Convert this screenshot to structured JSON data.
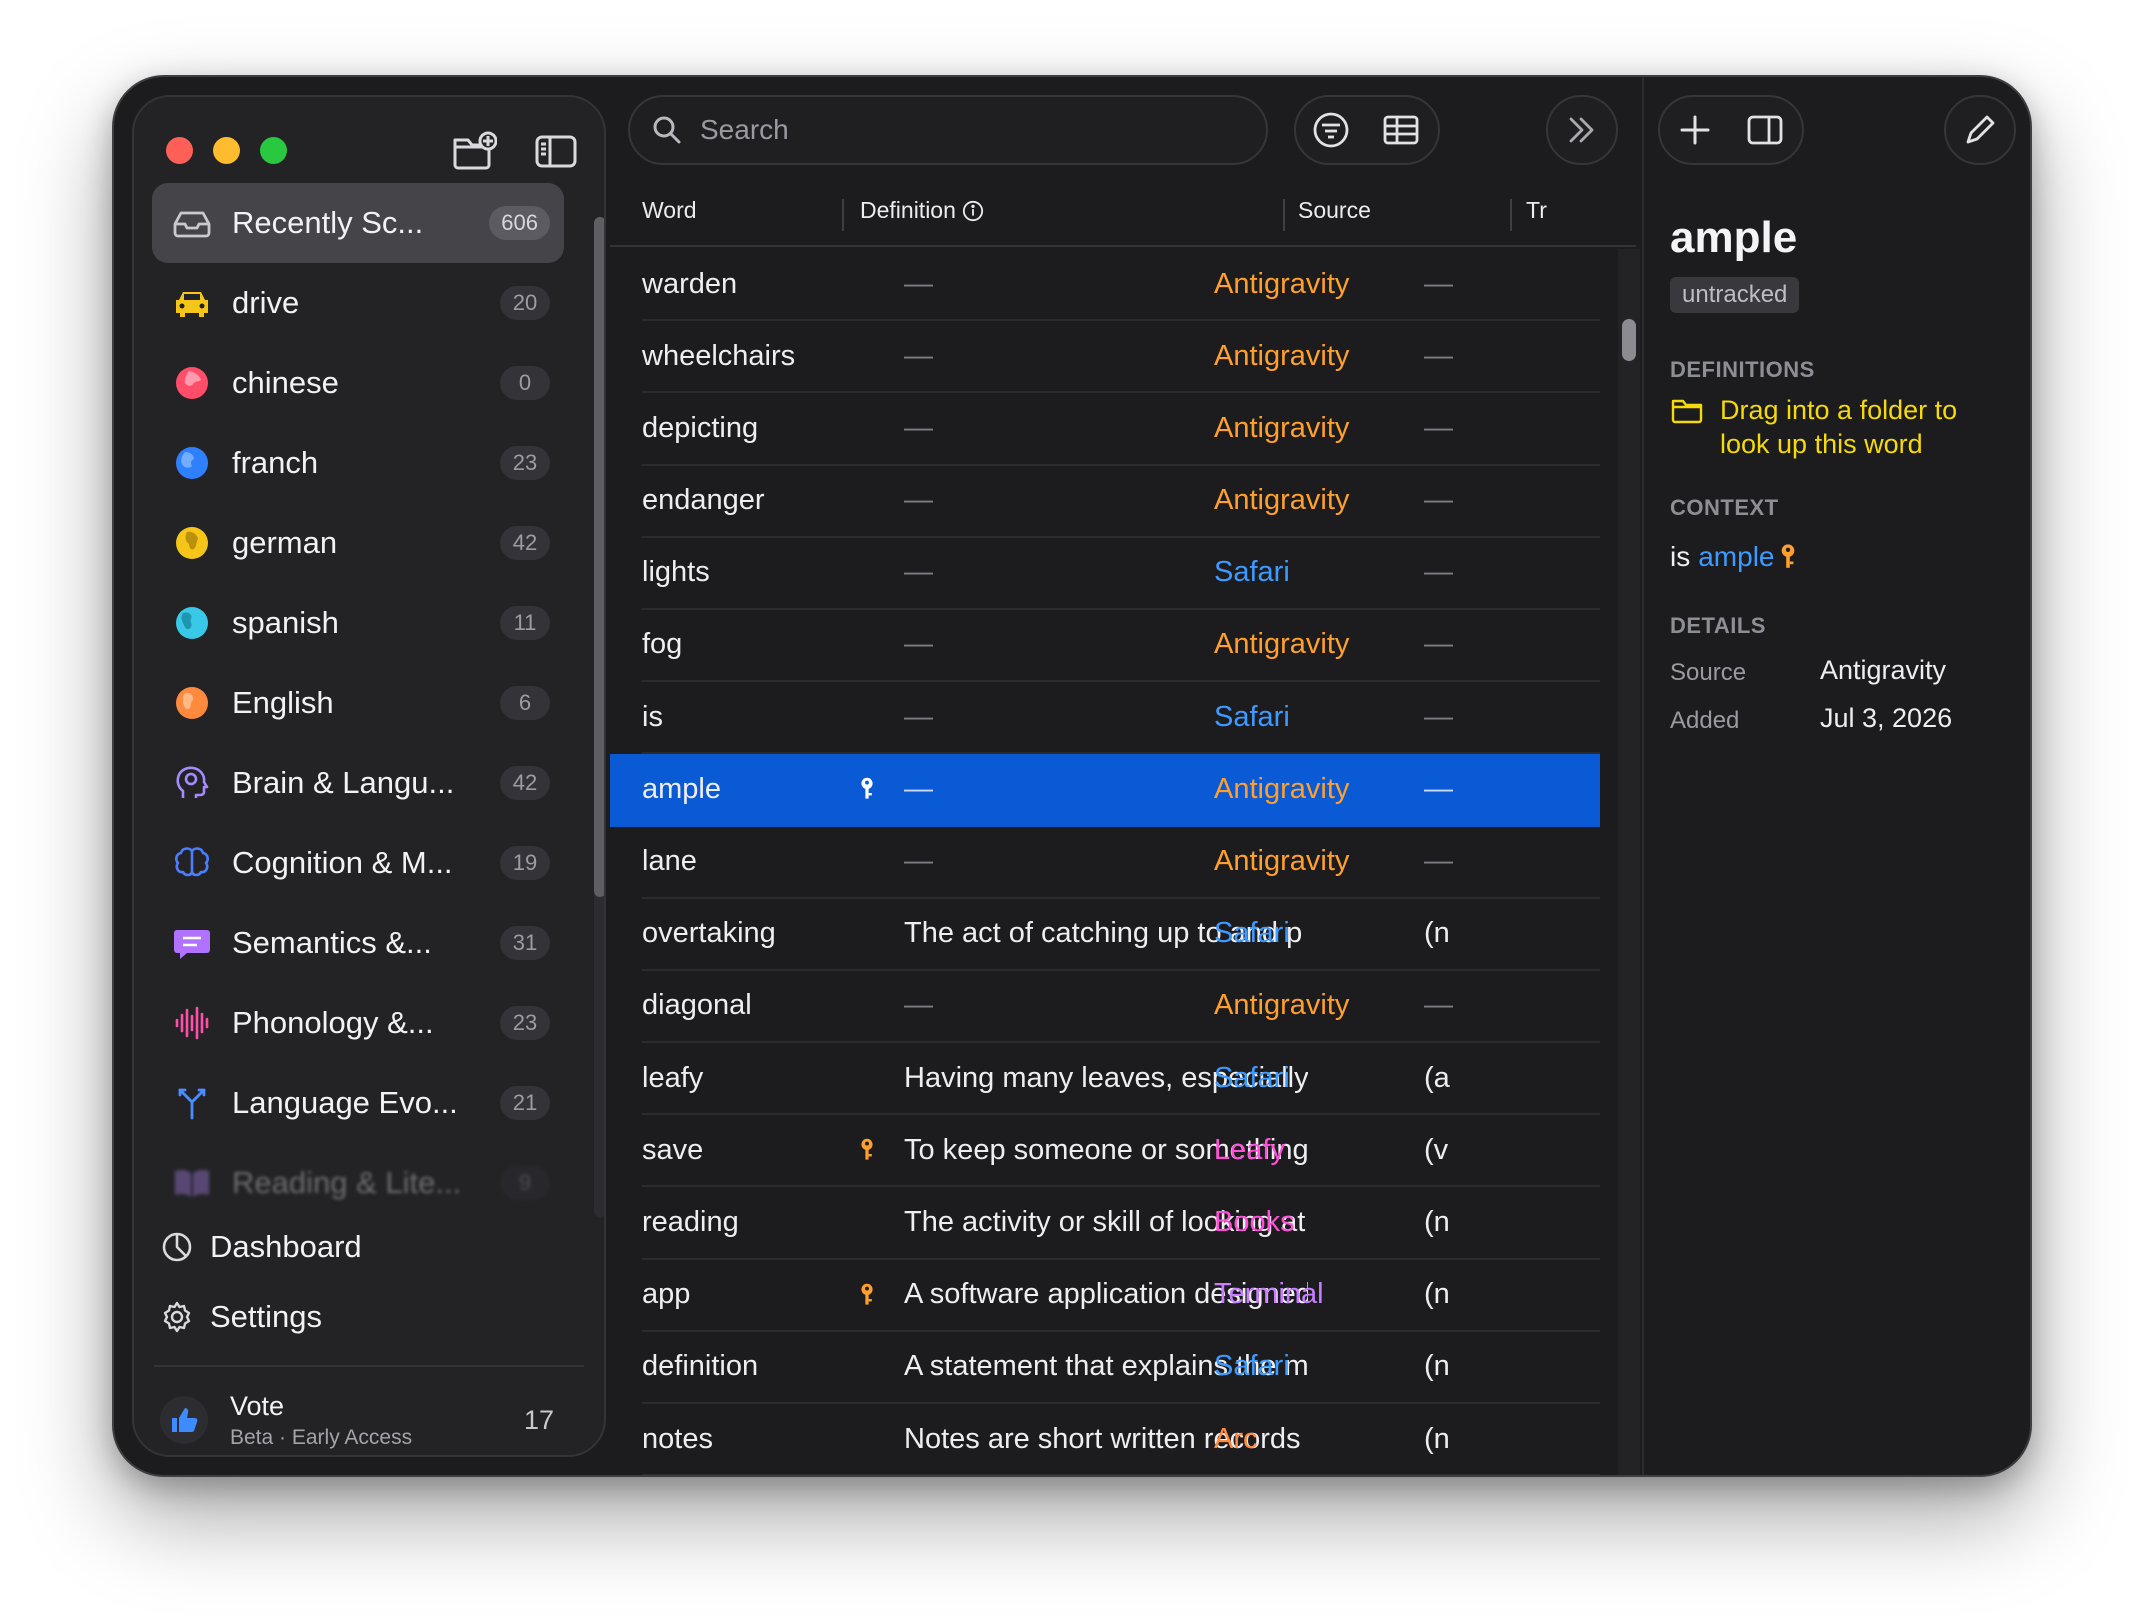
{
  "sidebar": {
    "items": [
      {
        "label": "Recently Sc...",
        "count": "606",
        "icon": "tray-icon",
        "color": "#c9c9ce"
      },
      {
        "label": "drive",
        "count": "20",
        "icon": "car-icon",
        "color": "#f5c518"
      },
      {
        "label": "chinese",
        "count": "0",
        "icon": "globe-asia-icon",
        "color": "#ff4d6a"
      },
      {
        "label": "franch",
        "count": "23",
        "icon": "globe-europe-icon",
        "color": "#2f80ff"
      },
      {
        "label": "german",
        "count": "42",
        "icon": "globe-africa-icon",
        "color": "#f5c518"
      },
      {
        "label": "spanish",
        "count": "11",
        "icon": "globe-americas-icon",
        "color": "#38c9e8"
      },
      {
        "label": "English",
        "count": "6",
        "icon": "globe-icon",
        "color": "#ff8a3d"
      },
      {
        "label": "Brain & Langu...",
        "count": "42",
        "icon": "head-profile-icon",
        "color": "#a68bff"
      },
      {
        "label": "Cognition & M...",
        "count": "19",
        "icon": "brain-icon",
        "color": "#4d7dff"
      },
      {
        "label": "Semantics &...",
        "count": "31",
        "icon": "speech-bubble-icon",
        "color": "#b072ff"
      },
      {
        "label": "Phonology &...",
        "count": "23",
        "icon": "waveform-icon",
        "color": "#ff4fa8"
      },
      {
        "label": "Language Evo...",
        "count": "21",
        "icon": "branch-icon",
        "color": "#4a8dff"
      },
      {
        "label": "Reading & Lite...",
        "count": "9",
        "icon": "book-icon",
        "color": "#b98cff"
      }
    ],
    "dashboard_label": "Dashboard",
    "settings_label": "Settings",
    "vote": {
      "title": "Vote",
      "subtitle": "Beta · Early Access",
      "count": "17"
    }
  },
  "toolbar": {
    "search_placeholder": "Search"
  },
  "table": {
    "columns": {
      "word": "Word",
      "definition": "Definition",
      "source": "Source",
      "translation": "Tr"
    },
    "rows": [
      {
        "word": "warden",
        "key": false,
        "definition": "—",
        "source": "Antigravity",
        "source_color": "#ff9f2e",
        "tr": "—"
      },
      {
        "word": "wheelchairs",
        "key": false,
        "definition": "—",
        "source": "Antigravity",
        "source_color": "#ff9f2e",
        "tr": "—"
      },
      {
        "word": "depicting",
        "key": false,
        "definition": "—",
        "source": "Antigravity",
        "source_color": "#ff9f2e",
        "tr": "—"
      },
      {
        "word": "endanger",
        "key": false,
        "definition": "—",
        "source": "Antigravity",
        "source_color": "#ff9f2e",
        "tr": "—"
      },
      {
        "word": "lights",
        "key": false,
        "definition": "—",
        "source": "Safari",
        "source_color": "#3d9bff",
        "tr": "—"
      },
      {
        "word": "fog",
        "key": false,
        "definition": "—",
        "source": "Antigravity",
        "source_color": "#ff9f2e",
        "tr": "—"
      },
      {
        "word": "is",
        "key": false,
        "definition": "—",
        "source": "Safari",
        "source_color": "#3d9bff",
        "tr": "—"
      },
      {
        "word": "ample",
        "key": true,
        "definition": "—",
        "source": "Antigravity",
        "source_color": "#ff9f2e",
        "tr": "—",
        "selected": true
      },
      {
        "word": "lane",
        "key": false,
        "definition": "—",
        "source": "Antigravity",
        "source_color": "#ff9f2e",
        "tr": "—"
      },
      {
        "word": "overtaking",
        "key": false,
        "definition": "The act of catching up to and p",
        "source": "Safari",
        "source_color": "#3d9bff",
        "tr": "(n"
      },
      {
        "word": "diagonal",
        "key": false,
        "definition": "—",
        "source": "Antigravity",
        "source_color": "#ff9f2e",
        "tr": "—"
      },
      {
        "word": "leafy",
        "key": false,
        "definition": "Having many leaves, especially",
        "source": "Safari",
        "source_color": "#3d9bff",
        "tr": "(a"
      },
      {
        "word": "save",
        "key": true,
        "definition": "To keep someone or something",
        "source": "Leafy",
        "source_color": "#ff4fd8",
        "tr": "(v"
      },
      {
        "word": "reading",
        "key": false,
        "definition": "The activity or skill of looking at",
        "source": "Books",
        "source_color": "#ff4fd8",
        "tr": "(n"
      },
      {
        "word": "app",
        "key": true,
        "definition": "A software application designed",
        "source": "Terminal",
        "source_color": "#c77dff",
        "tr": "(n"
      },
      {
        "word": "definition",
        "key": false,
        "definition": "A statement that explains the m",
        "source": "Safari",
        "source_color": "#3d9bff",
        "tr": "(n"
      },
      {
        "word": "notes",
        "key": false,
        "definition": "Notes are short written records",
        "source": "Arc",
        "source_color": "#ff8a3d",
        "tr": "(n"
      }
    ]
  },
  "inspector": {
    "word": "ample",
    "status": "untracked",
    "definitions_heading": "DEFINITIONS",
    "definitions_hint": "Drag into a folder to look up this word",
    "context_heading": "CONTEXT",
    "context_prefix": "is",
    "context_word": "ample",
    "details_heading": "DETAILS",
    "source_label": "Source",
    "source_value": "Antigravity",
    "added_label": "Added",
    "added_value": "Jul 3, 2026"
  },
  "colors": {
    "accent": "#0a5ad6",
    "key": "#ff9f2e",
    "hint": "#f5d90a"
  }
}
